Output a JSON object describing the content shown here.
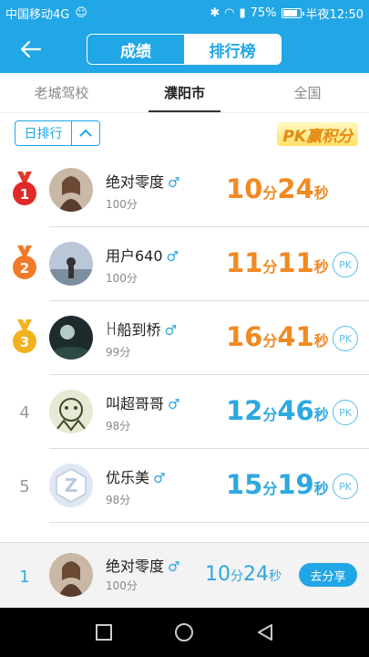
{
  "status": {
    "carrier": "中国移动4G",
    "battery": "75%",
    "time": "半夜12:50",
    "battery_fraction": 0.75
  },
  "header": {
    "seg_score": "成绩",
    "seg_rank": "排行榜"
  },
  "tabs": [
    "老城驾校",
    "濮阳市",
    "全国"
  ],
  "filter": {
    "label": "日排行",
    "pk_banner": "PK赢积分"
  },
  "gender_symbol": "♂",
  "pk_label": "PK",
  "unit_min": "分",
  "unit_sec": "秒",
  "rows": [
    {
      "rank": "1",
      "name": "绝对零度",
      "points": "100分",
      "min": "10",
      "sec": "24"
    },
    {
      "rank": "2",
      "name": "用户640",
      "points": "100分",
      "min": "11",
      "sec": "11"
    },
    {
      "rank": "3",
      "name": "ꀿ船到桥",
      "points": "99分",
      "min": "16",
      "sec": "41"
    },
    {
      "rank": "4",
      "name": "叫超哥哥",
      "points": "98分",
      "min": "12",
      "sec": "46"
    },
    {
      "rank": "5",
      "name": "优乐美",
      "points": "98分",
      "min": "15",
      "sec": "19"
    }
  ],
  "mine": {
    "rank": "1",
    "name": "绝对零度",
    "points": "100分",
    "min": "10",
    "sec": "24",
    "share": "去分享"
  },
  "colors": {
    "primary": "#21a6e6",
    "orange": "#f18a22",
    "blue": "#2ea8e0"
  }
}
